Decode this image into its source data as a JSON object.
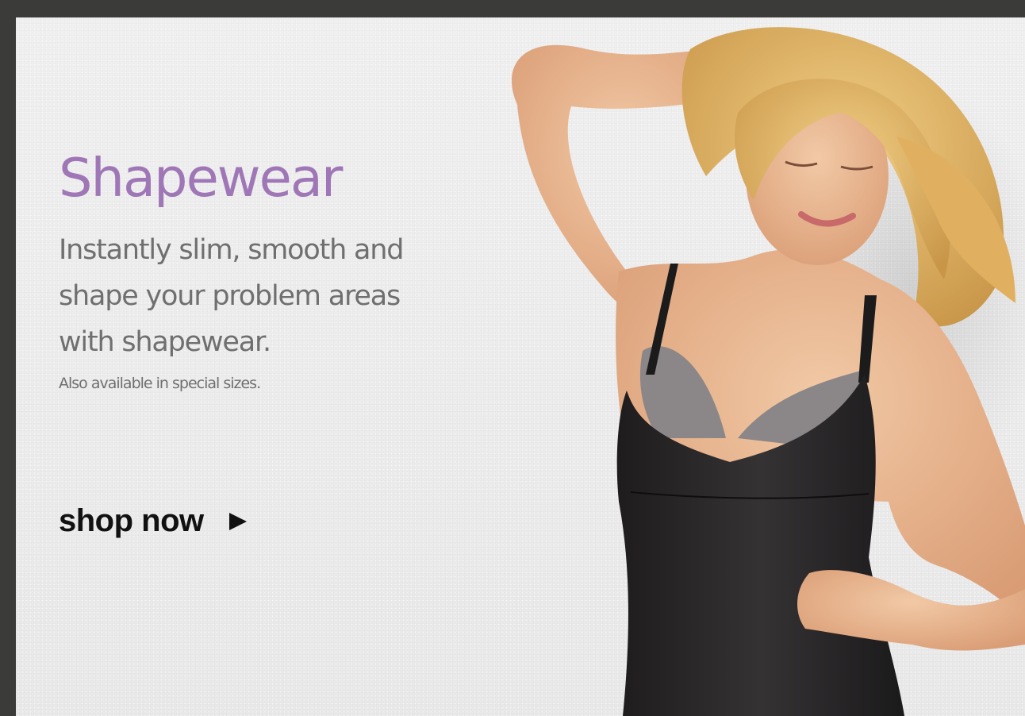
{
  "banner": {
    "headline": "Shapewear",
    "subhead_lines": [
      "Instantly slim, smooth and",
      "shape your problem areas",
      "with shapewear."
    ],
    "note": "Also available in special sizes.",
    "cta": {
      "label": "shop now",
      "icon": "play-arrow-icon"
    }
  },
  "colors": {
    "frame": "#3b3b39",
    "background": "#ececed",
    "headline": "#9f76b6",
    "body_text": "#6f6f6f",
    "cta": "#111111"
  }
}
